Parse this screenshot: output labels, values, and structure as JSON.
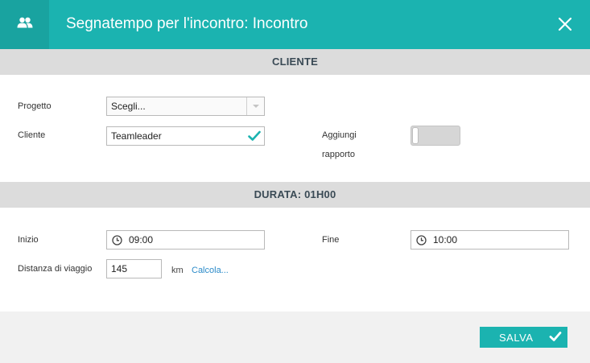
{
  "header": {
    "title": "Segnatempo per l'incontro: Incontro",
    "icon": "users-icon",
    "close_icon": "close-icon",
    "background_color": "#1bb3b0"
  },
  "sections": {
    "cliente_title": "CLIENTE",
    "durata_title": "DURATA: 01H00"
  },
  "cliente_section": {
    "progetto_label": "Progetto",
    "progetto_value": "Scegli...",
    "cliente_label": "Cliente",
    "cliente_value": "Teamleader",
    "aggiungi_label_line1": "Aggiungi",
    "aggiungi_label_line2": "rapporto",
    "aggiungi_toggle": "off"
  },
  "durata_section": {
    "inizio_label": "Inizio",
    "inizio_value": "09:00",
    "fine_label": "Fine",
    "fine_value": "10:00",
    "distanza_label": "Distanza di viaggio",
    "distanza_value": "145",
    "distanza_unit": "km",
    "calcola_link": "Calcola..."
  },
  "footer": {
    "save_label": "SALVA",
    "save_icon": "check-icon"
  }
}
